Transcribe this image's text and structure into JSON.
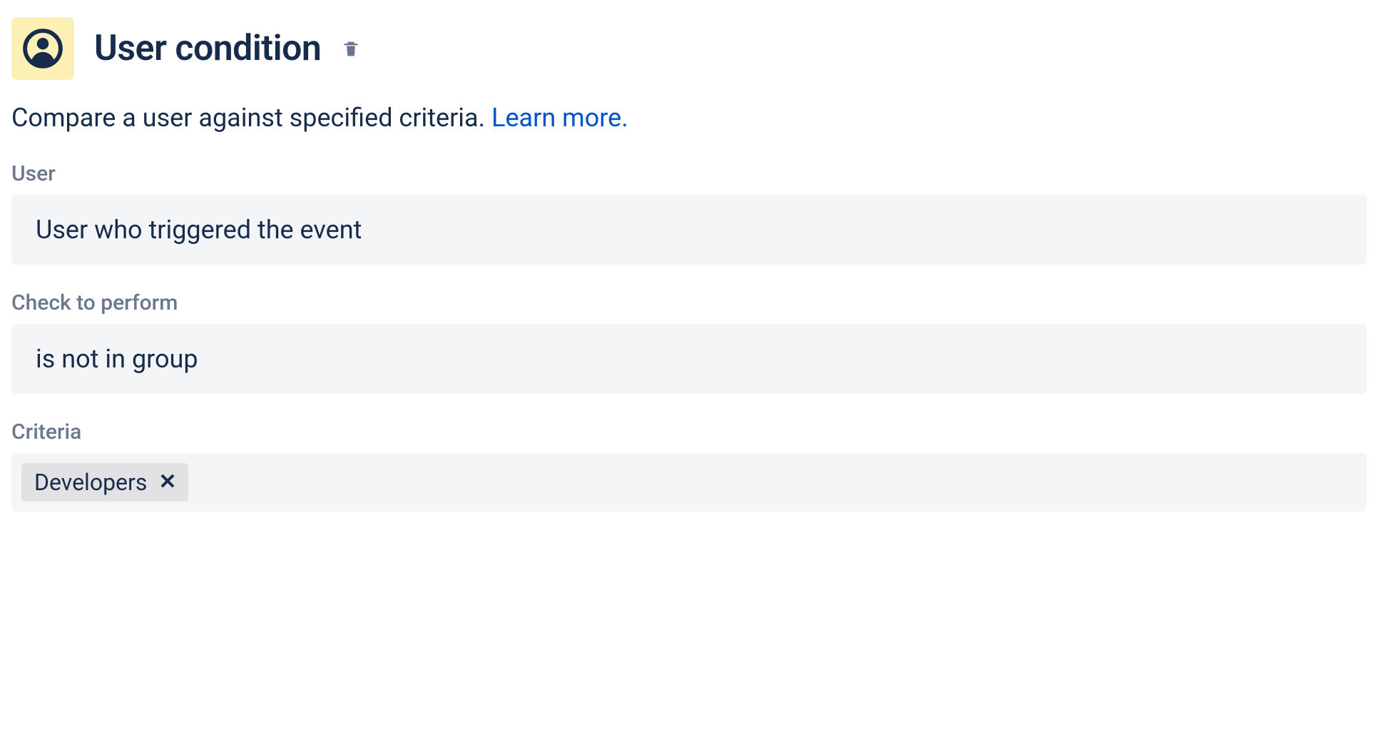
{
  "header": {
    "title": "User condition",
    "icon_name": "user-icon"
  },
  "description": {
    "text": "Compare a user against specified criteria. ",
    "link_text": "Learn more."
  },
  "fields": {
    "user": {
      "label": "User",
      "value": "User who triggered the event"
    },
    "check": {
      "label": "Check to perform",
      "value": "is not in group"
    },
    "criteria": {
      "label": "Criteria",
      "tags": [
        {
          "label": "Developers"
        }
      ]
    }
  }
}
